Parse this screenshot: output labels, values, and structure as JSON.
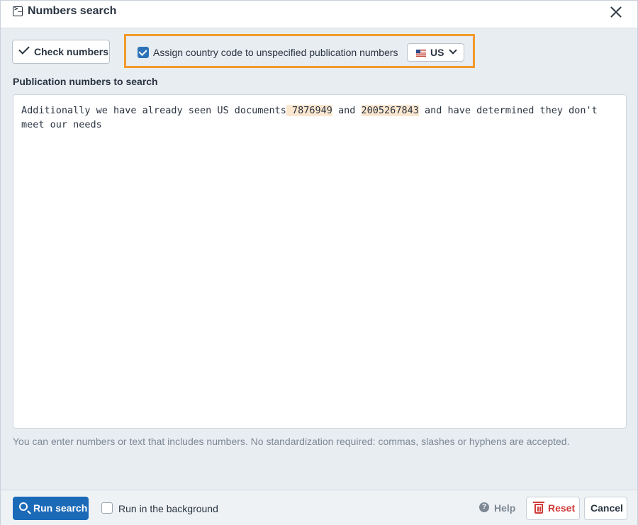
{
  "dialog": {
    "title": "Numbers search",
    "title_icon": "terminal-icon",
    "close_icon": "close-icon"
  },
  "toolbar": {
    "check_numbers_label": "Check numbers",
    "assign_country_checked": true,
    "assign_country_label": "Assign country code to unspecified publication numbers",
    "country_selected": "US",
    "country_flag_icon": "us-flag-icon"
  },
  "input": {
    "section_label": "Publication numbers to search",
    "text_before": "Additionally we have already seen US documents",
    "number_1": " 7876949",
    "text_between": " and ",
    "number_2": "2005267843",
    "text_after": " and have determined they don't meet our needs",
    "highlight_color": "#fbe7cf",
    "hint": "You can enter numbers or text that includes numbers. No standardization required: commas, slashes or hyphens are accepted."
  },
  "footer": {
    "run_search_label": "Run search",
    "run_background_checked": false,
    "run_background_label": "Run in the background",
    "help_label": "Help",
    "reset_label": "Reset",
    "cancel_label": "Cancel"
  },
  "colors": {
    "primary": "#1b6ab8",
    "focus_outline": "#f39a2c",
    "danger": "#d13b3b"
  }
}
